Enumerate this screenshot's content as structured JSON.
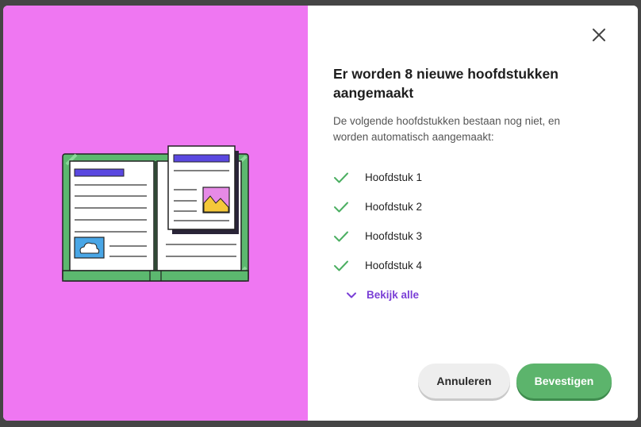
{
  "dialog": {
    "title": "Er worden 8 nieuwe hoofdstukken aangemaakt",
    "description": "De volgende hoofdstukken bestaan nog niet, en worden automatisch aangemaakt:",
    "chapters": [
      {
        "label": "Hoofdstuk 1"
      },
      {
        "label": "Hoofdstuk 2"
      },
      {
        "label": "Hoofdstuk 3"
      },
      {
        "label": "Hoofdstuk 4"
      }
    ],
    "view_all_label": "Bekijk alle",
    "cancel_label": "Annuleren",
    "confirm_label": "Bevestigen",
    "close_icon": "close-icon",
    "check_icon": "check-icon"
  },
  "colors": {
    "illustration_bg": "#ef77f2",
    "accent_purple": "#7a3fd6",
    "confirm_green": "#5cb46c",
    "check_green": "#4caf62"
  }
}
